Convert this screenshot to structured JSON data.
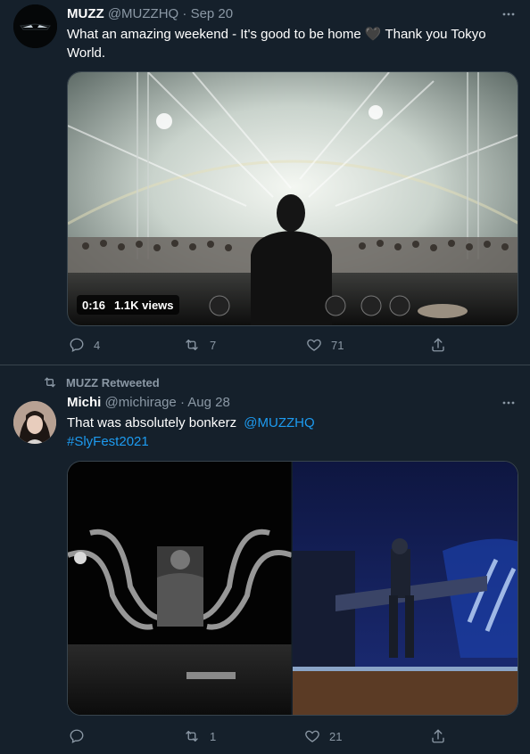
{
  "tweets": [
    {
      "name": "MUZZ",
      "handle": "@MUZZHQ",
      "separator": "·",
      "date": "Sep 20",
      "text": "What an amazing weekend - It's good to be home 🖤 Thank you Tokyo World.",
      "media": {
        "type": "video",
        "duration": "0:16",
        "views": "1.1K views"
      },
      "actions": {
        "replies": "4",
        "retweets": "7",
        "likes": "71"
      }
    },
    {
      "retweeted_by": "MUZZ Retweeted",
      "name": "Michi",
      "handle": "@michirage",
      "separator": "·",
      "date": "Aug 28",
      "text": "That was absolutely bonkerz",
      "mention": "@MUZZHQ",
      "hashtag": "#SlyFest2021",
      "media": {
        "type": "images",
        "count": 2
      },
      "actions": {
        "replies": "",
        "retweets": "1",
        "likes": "21"
      }
    }
  ],
  "colors": {
    "background": "#15202b",
    "secondary_text": "#8b98a5",
    "link": "#1d9bf0",
    "border": "#38444d"
  }
}
